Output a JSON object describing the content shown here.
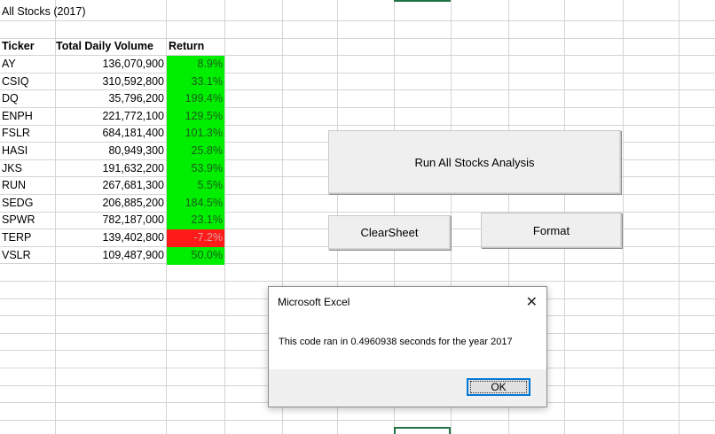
{
  "sheet": {
    "title": "All Stocks (2017)",
    "headers": {
      "ticker": "Ticker",
      "volume": "Total Daily Volume",
      "return": "Return"
    },
    "rows": [
      {
        "ticker": "AY",
        "volume": "136,070,900",
        "return": "8.9%",
        "status": "positive"
      },
      {
        "ticker": "CSIQ",
        "volume": "310,592,800",
        "return": "33.1%",
        "status": "positive"
      },
      {
        "ticker": "DQ",
        "volume": "35,796,200",
        "return": "199.4%",
        "status": "positive"
      },
      {
        "ticker": "ENPH",
        "volume": "221,772,100",
        "return": "129.5%",
        "status": "positive"
      },
      {
        "ticker": "FSLR",
        "volume": "684,181,400",
        "return": "101.3%",
        "status": "positive"
      },
      {
        "ticker": "HASI",
        "volume": "80,949,300",
        "return": "25.8%",
        "status": "positive"
      },
      {
        "ticker": "JKS",
        "volume": "191,632,200",
        "return": "53.9%",
        "status": "positive"
      },
      {
        "ticker": "RUN",
        "volume": "267,681,300",
        "return": "5.5%",
        "status": "positive"
      },
      {
        "ticker": "SEDG",
        "volume": "206,885,200",
        "return": "184.5%",
        "status": "positive"
      },
      {
        "ticker": "SPWR",
        "volume": "782,187,000",
        "return": "23.1%",
        "status": "positive"
      },
      {
        "ticker": "TERP",
        "volume": "139,402,800",
        "return": "-7.2%",
        "status": "negative"
      },
      {
        "ticker": "VSLR",
        "volume": "109,487,900",
        "return": "50.0%",
        "status": "positive"
      }
    ]
  },
  "buttons": {
    "run_analysis": "Run All Stocks Analysis",
    "clear_sheet": "ClearSheet",
    "format": "Format"
  },
  "dialog": {
    "title": "Microsoft Excel",
    "message": "This code ran in 0.4960938 seconds for the year 2017",
    "ok_label": "OK",
    "close_icon": "close-icon"
  },
  "colors": {
    "positive": "#00ee00",
    "negative": "#ff1a1a",
    "gridline": "#d4d4d4",
    "selection": "#217346"
  }
}
